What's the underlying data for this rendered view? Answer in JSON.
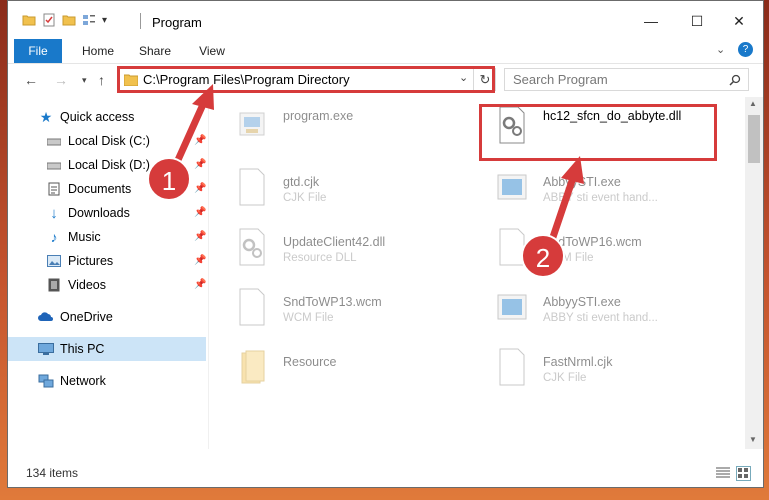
{
  "window": {
    "title": "Program"
  },
  "ribbon": {
    "tabs": [
      "File",
      "Home",
      "Share",
      "View"
    ]
  },
  "address": {
    "path": "C:\\Program Files\\Program Directory"
  },
  "search": {
    "placeholder": "Search Program"
  },
  "sidebar": {
    "items": [
      {
        "label": "Quick access",
        "icon": "star-icon"
      },
      {
        "label": "Local Disk (C:)",
        "icon": "drive-icon"
      },
      {
        "label": "Local Disk (D:)",
        "icon": "drive-icon"
      },
      {
        "label": "Documents",
        "icon": "document-icon"
      },
      {
        "label": "Downloads",
        "icon": "download-icon"
      },
      {
        "label": "Music",
        "icon": "music-icon"
      },
      {
        "label": "Pictures",
        "icon": "picture-icon"
      },
      {
        "label": "Videos",
        "icon": "video-icon"
      },
      {
        "label": "OneDrive",
        "icon": "cloud-icon"
      },
      {
        "label": "This PC",
        "icon": "computer-icon"
      },
      {
        "label": "Network",
        "icon": "network-icon"
      }
    ]
  },
  "files": [
    {
      "name": "program.exe",
      "type": ""
    },
    {
      "name": "hc12_sfcn_do_abbyte.dll",
      "type": ""
    },
    {
      "name": "gtd.cjk",
      "type": "CJK File"
    },
    {
      "name": "AbbyySTI.exe",
      "type": "ABBY sti event hand..."
    },
    {
      "name": "UpdateClient42.dll",
      "type": "Resource DLL"
    },
    {
      "name": "SndToWP16.wcm",
      "type": "WCM File"
    },
    {
      "name": "SndToWP13.wcm",
      "type": "WCM File"
    },
    {
      "name": "AbbyySTI.exe",
      "type": "ABBY sti event hand..."
    },
    {
      "name": "Resource",
      "type": ""
    },
    {
      "name": "FastNrml.cjk",
      "type": "CJK File"
    }
  ],
  "status": {
    "count": "134 items"
  },
  "annotations": {
    "step1": "1",
    "step2": "2",
    "color": "#d63b3b"
  },
  "colors": {
    "accent": "#1979ca",
    "selection": "#cce4f7"
  }
}
